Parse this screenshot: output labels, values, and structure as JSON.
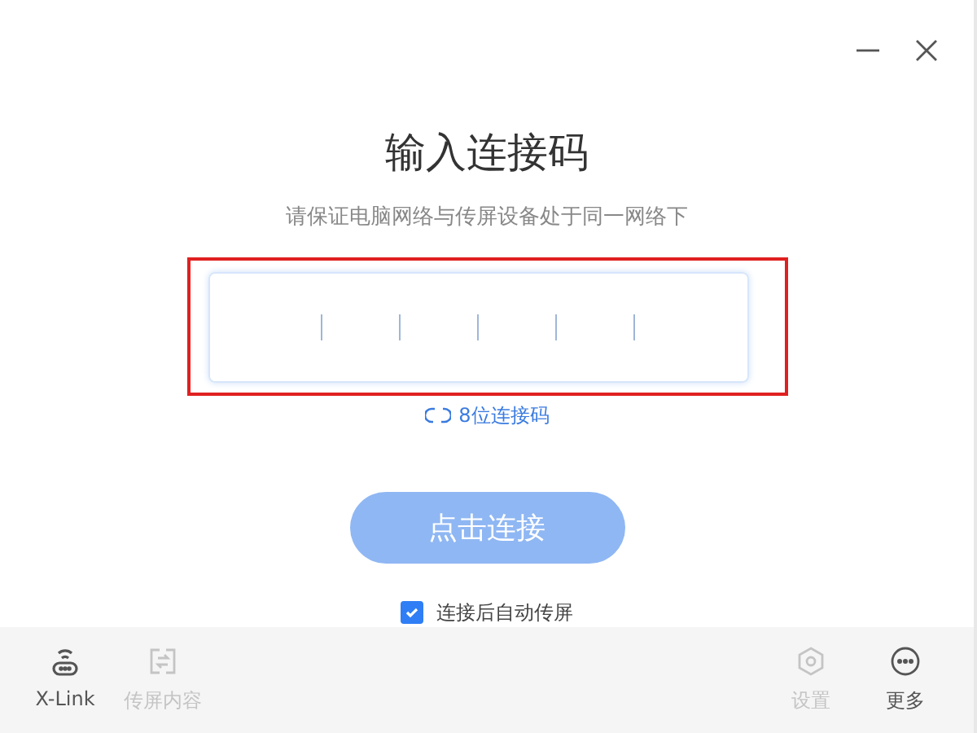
{
  "window": {
    "controls": [
      {
        "kind": "minimize"
      },
      {
        "kind": "close"
      }
    ]
  },
  "title": "输入连接码",
  "subtitle": "请保证电脑网络与传屏设备处于同一网络下",
  "code_input": {
    "highlighted": true
  },
  "switch_link": "8位连接码",
  "connect_button": {
    "label": "点击连接",
    "disabled": true
  },
  "auto_cast": {
    "label": "连接后自动传屏",
    "checked": true
  },
  "bottom_bar": {
    "left": [
      {
        "kind": "xlink",
        "label": "X-Link",
        "disabled": false
      },
      {
        "kind": "cast",
        "label": "传屏内容",
        "disabled": true
      }
    ],
    "right": [
      {
        "kind": "settings",
        "label": "设置",
        "disabled": true
      },
      {
        "kind": "more",
        "label": "更多",
        "disabled": false
      }
    ]
  }
}
